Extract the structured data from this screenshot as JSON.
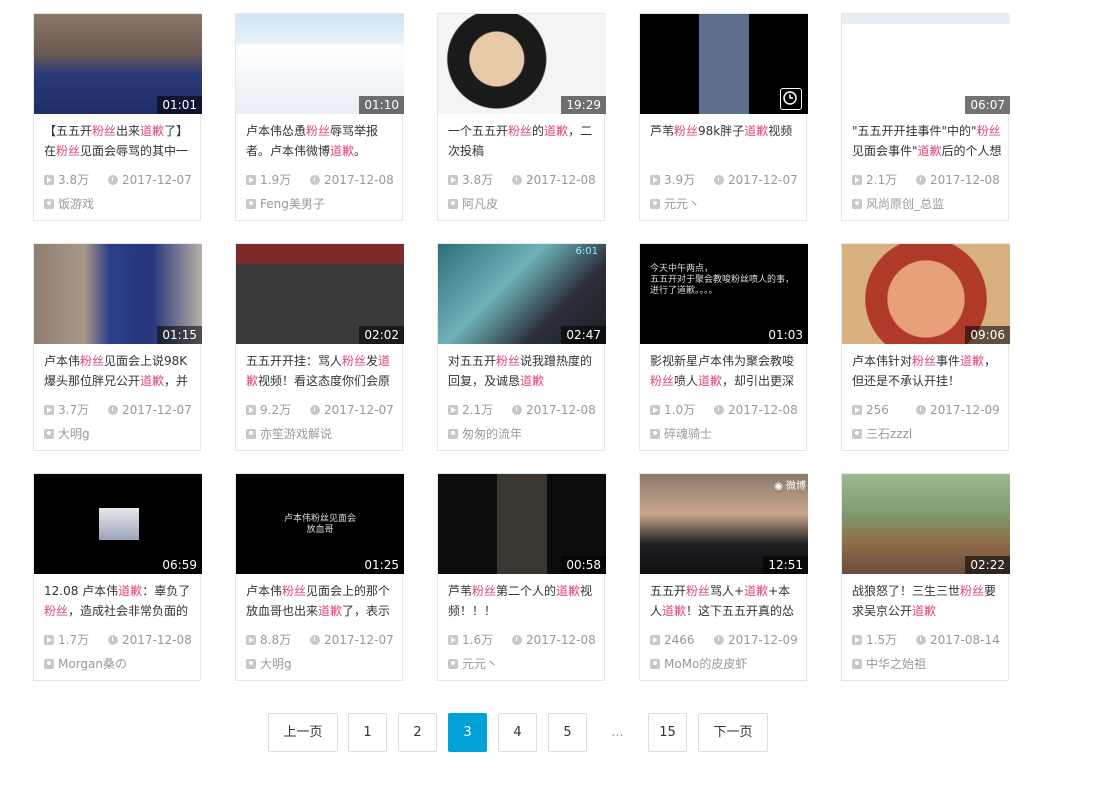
{
  "colors": {
    "highlight": "#e3477f",
    "accent": "#00a1d6"
  },
  "videos": [
    {
      "duration": "01:01",
      "title": [
        [
          "【五五开",
          0
        ],
        [
          "粉丝",
          1
        ],
        [
          "出来",
          0
        ],
        [
          "道歉",
          1
        ],
        [
          "了】在",
          0
        ],
        [
          "粉丝",
          1
        ],
        [
          "见面会辱骂的其中一",
          0
        ]
      ],
      "views": "3.8万",
      "date": "2017-12-07",
      "author": "饭游戏"
    },
    {
      "duration": "01:10",
      "title": [
        [
          "卢本伟怂恿",
          0
        ],
        [
          "粉丝",
          1
        ],
        [
          "辱骂举报者。卢本伟微博",
          0
        ],
        [
          "道歉",
          1
        ],
        [
          "。",
          0
        ]
      ],
      "views": "1.9万",
      "date": "2017-12-08",
      "author": "Feng美男子"
    },
    {
      "duration": "19:29",
      "title": [
        [
          "一个五五开",
          0
        ],
        [
          "粉丝",
          1
        ],
        [
          "的",
          0
        ],
        [
          "道歉",
          1
        ],
        [
          "，二次投稿",
          0
        ]
      ],
      "views": "3.8万",
      "date": "2017-12-08",
      "author": "阿凡皮"
    },
    {
      "duration": "",
      "title": [
        [
          "芦苇",
          0
        ],
        [
          "粉丝",
          1
        ],
        [
          "98k胖子",
          0
        ],
        [
          "道歉",
          1
        ],
        [
          "视频",
          0
        ]
      ],
      "views": "3.9万",
      "date": "2017-12-07",
      "author": "元元丶"
    },
    {
      "duration": "06:07",
      "title": [
        [
          "\"五五开开挂事件\"中的\"",
          0
        ],
        [
          "粉丝",
          1
        ],
        [
          "见面会事件\"",
          0
        ],
        [
          "道歉",
          1
        ],
        [
          "后的个人想",
          0
        ]
      ],
      "views": "2.1万",
      "date": "2017-12-08",
      "author": "风尚原创_总监"
    },
    {
      "duration": "01:15",
      "title": [
        [
          "卢本伟",
          0
        ],
        [
          "粉丝",
          1
        ],
        [
          "见面会上说98K爆头那位胖兄公开",
          0
        ],
        [
          "道歉",
          1
        ],
        [
          "，并",
          0
        ]
      ],
      "views": "3.7万",
      "date": "2017-12-07",
      "author": "大明g"
    },
    {
      "duration": "02:02",
      "title": [
        [
          "五五开开挂：骂人",
          0
        ],
        [
          "粉丝",
          1
        ],
        [
          "发",
          0
        ],
        [
          "道歉",
          1
        ],
        [
          "视频！看这态度你们会原",
          0
        ]
      ],
      "views": "9.2万",
      "date": "2017-12-07",
      "author": "亦笙游戏解说"
    },
    {
      "duration": "02:47",
      "title": [
        [
          "对五五开",
          0
        ],
        [
          "粉丝",
          1
        ],
        [
          "说我蹭热度的回复，及诚恳",
          0
        ],
        [
          "道歉",
          1
        ]
      ],
      "views": "2.1万",
      "date": "2017-12-08",
      "author": "匆匆的流年"
    },
    {
      "duration": "01:03",
      "title": [
        [
          "影视新星卢本伟为聚会教唆",
          0
        ],
        [
          "粉丝",
          1
        ],
        [
          "喷人",
          0
        ],
        [
          "道歉",
          1
        ],
        [
          "，却引出更深",
          0
        ]
      ],
      "views": "1.0万",
      "date": "2017-12-08",
      "author": "碎魂骑士"
    },
    {
      "duration": "09:06",
      "title": [
        [
          "卢本伟针对",
          0
        ],
        [
          "粉丝",
          1
        ],
        [
          "事件",
          0
        ],
        [
          "道歉",
          1
        ],
        [
          "，但还是不承认开挂！",
          0
        ]
      ],
      "views": "256",
      "date": "2017-12-09",
      "author": "三石zzzl"
    },
    {
      "duration": "06:59",
      "title": [
        [
          "12.08 卢本伟",
          0
        ],
        [
          "道歉",
          1
        ],
        [
          "：辜负了",
          0
        ],
        [
          "粉丝",
          1
        ],
        [
          "，造成社会非常负面的",
          0
        ]
      ],
      "views": "1.7万",
      "date": "2017-12-08",
      "author": "Morgan桑の"
    },
    {
      "duration": "01:25",
      "title": [
        [
          "卢本伟",
          0
        ],
        [
          "粉丝",
          1
        ],
        [
          "见面会上的那个放血哥也出来",
          0
        ],
        [
          "道歉",
          1
        ],
        [
          "了，表示",
          0
        ]
      ],
      "views": "8.8万",
      "date": "2017-12-07",
      "author": "大明g"
    },
    {
      "duration": "00:58",
      "title": [
        [
          "芦苇",
          0
        ],
        [
          "粉丝",
          1
        ],
        [
          "第二个人的",
          0
        ],
        [
          "道歉",
          1
        ],
        [
          "视频！！！",
          0
        ]
      ],
      "views": "1.6万",
      "date": "2017-12-08",
      "author": "元元丶"
    },
    {
      "duration": "12:51",
      "title": [
        [
          "五五开",
          0
        ],
        [
          "粉丝",
          1
        ],
        [
          "骂人+",
          0
        ],
        [
          "道歉",
          1
        ],
        [
          "+本人",
          0
        ],
        [
          "道歉",
          1
        ],
        [
          "！这下五五开真的怂",
          0
        ]
      ],
      "views": "2466",
      "date": "2017-12-09",
      "author": "MoMo的皮皮虾"
    },
    {
      "duration": "02:22",
      "title": [
        [
          "战狼怒了！三生三世",
          0
        ],
        [
          "粉丝",
          1
        ],
        [
          "要求吴京公开",
          0
        ],
        [
          "道歉",
          1
        ]
      ],
      "views": "1.5万",
      "date": "2017-08-14",
      "author": "中华之始祖"
    }
  ],
  "thumb_text": {
    "v9": "今天中午两点，\n五五开对于聚会教唆粉丝喷人的事，\n进行了道歉。。。。",
    "v12": "卢本伟粉丝见面会\n放血哥",
    "v7_time": "6:01",
    "v14_logo": "◉ 微博"
  },
  "pagination": {
    "prev": "上一页",
    "pages": [
      "1",
      "2",
      "3",
      "4",
      "5"
    ],
    "current": "3",
    "ellipsis": "...",
    "last": "15",
    "next": "下一页"
  },
  "icons": {
    "views": "play-count-icon",
    "date": "clock-icon",
    "author": "user-icon",
    "watch_later": "watch-later-icon"
  }
}
